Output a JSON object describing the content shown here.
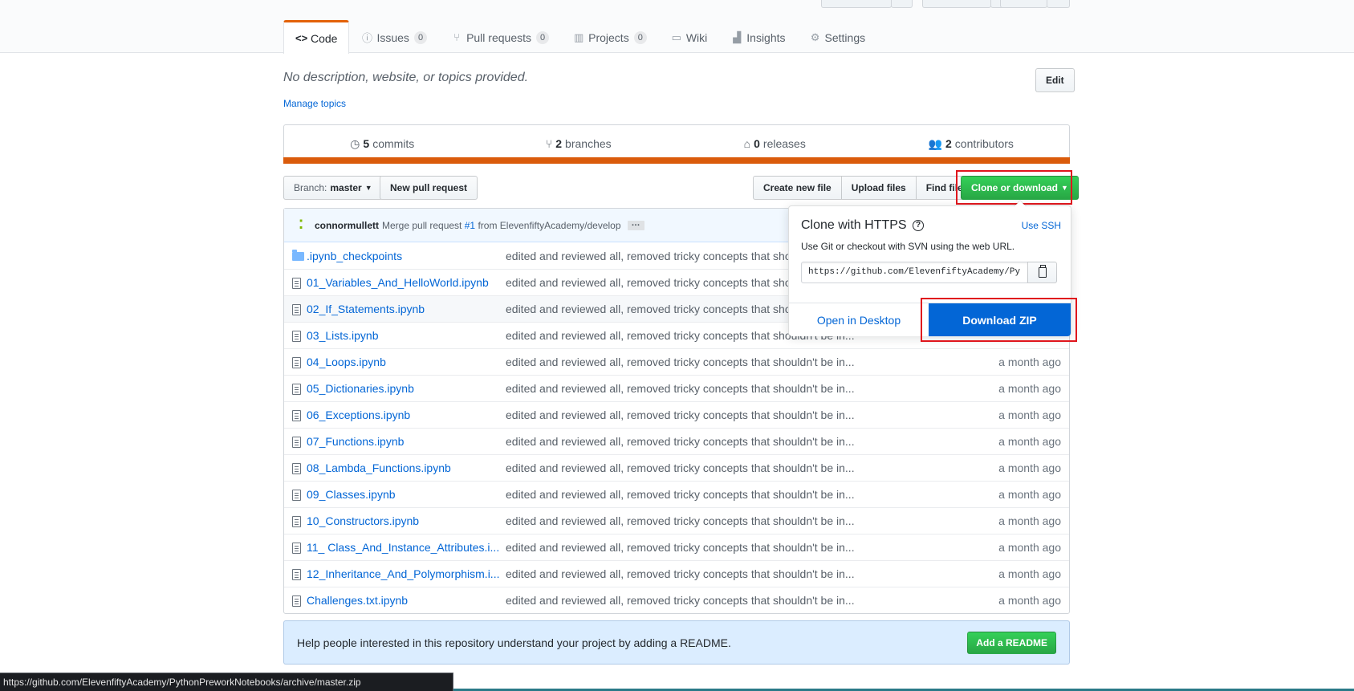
{
  "header": {
    "tabs": [
      {
        "label": "Code",
        "icon": "code-icon"
      },
      {
        "label": "Issues",
        "icon": "issue-icon",
        "count": "0"
      },
      {
        "label": "Pull requests",
        "icon": "pull-request-icon",
        "count": "0"
      },
      {
        "label": "Projects",
        "icon": "project-icon",
        "count": "0"
      },
      {
        "label": "Wiki",
        "icon": "book-icon"
      },
      {
        "label": "Insights",
        "icon": "graph-icon"
      },
      {
        "label": "Settings",
        "icon": "gear-icon"
      }
    ]
  },
  "repo": {
    "description": "No description, website, or topics provided.",
    "manage_topics": "Manage topics",
    "edit_label": "Edit",
    "commits_count": "5",
    "commits_label": "commits",
    "branches_count": "2",
    "branches_label": "branches",
    "releases_count": "0",
    "releases_label": "releases",
    "contributors_count": "2",
    "contributors_label": "contributors",
    "language_color": "#DA5B0B"
  },
  "toolbar": {
    "branch_prefix": "Branch:",
    "branch_name": "master",
    "new_pr": "New pull request",
    "create_file": "Create new file",
    "upload_files": "Upload files",
    "find_file": "Find file",
    "clone_download": "Clone or download"
  },
  "commit": {
    "author": "connormullett",
    "message_prefix": "Merge pull request",
    "pr_link": "#1",
    "message_suffix": "from ElevenfiftyAcademy/develop",
    "more": "…"
  },
  "files": [
    {
      "name": ".ipynb_checkpoints",
      "type": "folder",
      "message": "edited and reviewed all, removed tricky concepts that shou",
      "age": ""
    },
    {
      "name": "01_Variables_And_HelloWorld.ipynb",
      "type": "file",
      "message": "edited and reviewed all, removed tricky concepts that shou",
      "age": ""
    },
    {
      "name": "02_If_Statements.ipynb",
      "type": "file",
      "message": "edited and reviewed all, removed tricky concepts that shou",
      "age": ""
    },
    {
      "name": "03_Lists.ipynb",
      "type": "file",
      "message": "edited and reviewed all, removed tricky concepts that shouldn't be in...",
      "age": ""
    },
    {
      "name": "04_Loops.ipynb",
      "type": "file",
      "message": "edited and reviewed all, removed tricky concepts that shouldn't be in...",
      "age": "a month ago"
    },
    {
      "name": "05_Dictionaries.ipynb",
      "type": "file",
      "message": "edited and reviewed all, removed tricky concepts that shouldn't be in...",
      "age": "a month ago"
    },
    {
      "name": "06_Exceptions.ipynb",
      "type": "file",
      "message": "edited and reviewed all, removed tricky concepts that shouldn't be in...",
      "age": "a month ago"
    },
    {
      "name": "07_Functions.ipynb",
      "type": "file",
      "message": "edited and reviewed all, removed tricky concepts that shouldn't be in...",
      "age": "a month ago"
    },
    {
      "name": "08_Lambda_Functions.ipynb",
      "type": "file",
      "message": "edited and reviewed all, removed tricky concepts that shouldn't be in...",
      "age": "a month ago"
    },
    {
      "name": "09_Classes.ipynb",
      "type": "file",
      "message": "edited and reviewed all, removed tricky concepts that shouldn't be in...",
      "age": "a month ago"
    },
    {
      "name": "10_Constructors.ipynb",
      "type": "file",
      "message": "edited and reviewed all, removed tricky concepts that shouldn't be in...",
      "age": "a month ago"
    },
    {
      "name": "11_ Class_And_Instance_Attributes.i...",
      "type": "file",
      "message": "edited and reviewed all, removed tricky concepts that shouldn't be in...",
      "age": "a month ago"
    },
    {
      "name": "12_Inheritance_And_Polymorphism.i...",
      "type": "file",
      "message": "edited and reviewed all, removed tricky concepts that shouldn't be in...",
      "age": "a month ago"
    },
    {
      "name": "Challenges.txt.ipynb",
      "type": "file",
      "message": "edited and reviewed all, removed tricky concepts that shouldn't be in...",
      "age": "a month ago"
    }
  ],
  "clone_dropdown": {
    "title": "Clone with HTTPS",
    "use_ssh": "Use SSH",
    "subtitle": "Use Git or checkout with SVN using the web URL.",
    "url": "https://github.com/ElevenfiftyAcademy/Py",
    "open_desktop": "Open in Desktop",
    "download_zip": "Download ZIP"
  },
  "readme_banner": {
    "text": "Help people interested in this repository understand your project by adding a README.",
    "button": "Add a README"
  },
  "status_bar": {
    "url": "https://github.com/ElevenfiftyAcademy/PythonPreworkNotebooks/archive/master.zip"
  },
  "colors": {
    "accent_orange": "#e36209",
    "link_blue": "#0366d6",
    "green_button": "#28a745",
    "highlight_red": "#e0161d"
  }
}
